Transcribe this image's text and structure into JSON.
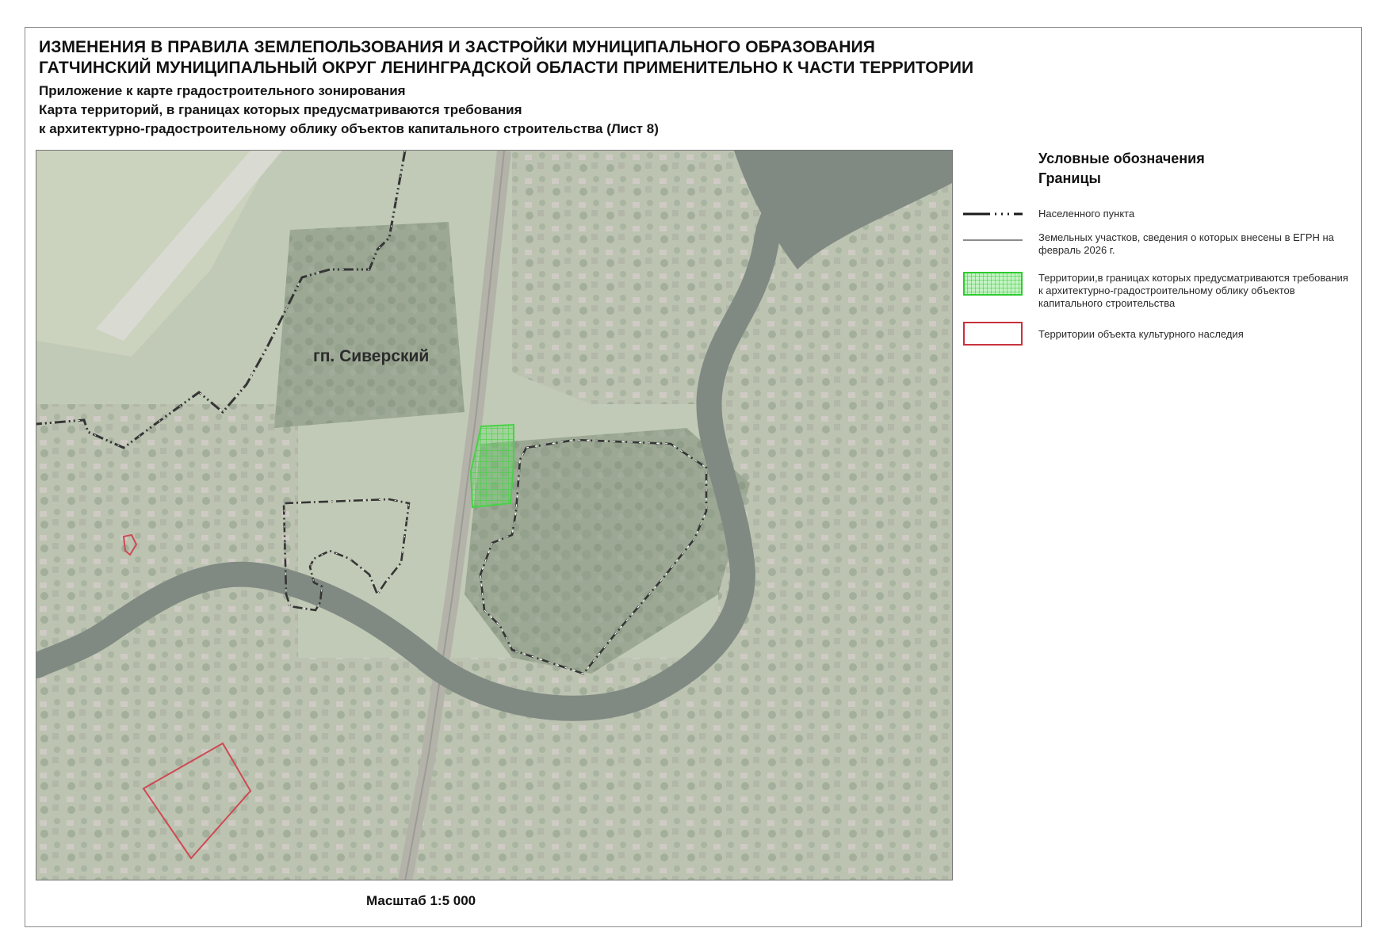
{
  "header": {
    "title_line1": "ИЗМЕНЕНИЯ В ПРАВИЛА ЗЕМЛЕПОЛЬЗОВАНИЯ И ЗАСТРОЙКИ МУНИЦИПАЛЬНОГО ОБРАЗОВАНИЯ",
    "title_line2": "ГАТЧИНСКИЙ МУНИЦИПАЛЬНЫЙ ОКРУГ ЛЕНИНГРАДСКОЙ ОБЛАСТИ ПРИМЕНИТЕЛЬНО К ЧАСТИ ТЕРРИТОРИИ",
    "subtitle_line1": "Приложение к карте градостроительного зонирования",
    "subtitle_line2": "Карта территорий, в границах которых предусматриваются требования",
    "subtitle_line3": "к архитектурно-градостроительному облику объектов капитального строительства (Лист 8)"
  },
  "map": {
    "settlement_label": "гп. Сиверский"
  },
  "scale": "Масштаб 1:5 000",
  "legend": {
    "title": "Условные обозначения",
    "section": "Границы",
    "items": [
      {
        "label": "Населенного пункта",
        "symbol": "dash-dot-line",
        "color": "#1a1a1a"
      },
      {
        "label": "Земельных участков, сведения о которых внесены в ЕГРН на февраль 2026 г.",
        "symbol": "thin-line",
        "color": "#8c8c8c"
      },
      {
        "label": "Территории,в границах которых предусматриваются требования к архитектурно-градостроительному облику объектов капитального строительства",
        "symbol": "green-grid",
        "color": "#2ecc2e"
      },
      {
        "label": "Территории объекта культурного наследия",
        "symbol": "red-outline",
        "color": "#c8323c"
      }
    ]
  },
  "colors": {
    "settlement_boundary": "#1a1a1a",
    "design_requirement_zone": "#2ecc2e",
    "heritage_zone": "#c8323c",
    "water": "#6f7a72"
  }
}
